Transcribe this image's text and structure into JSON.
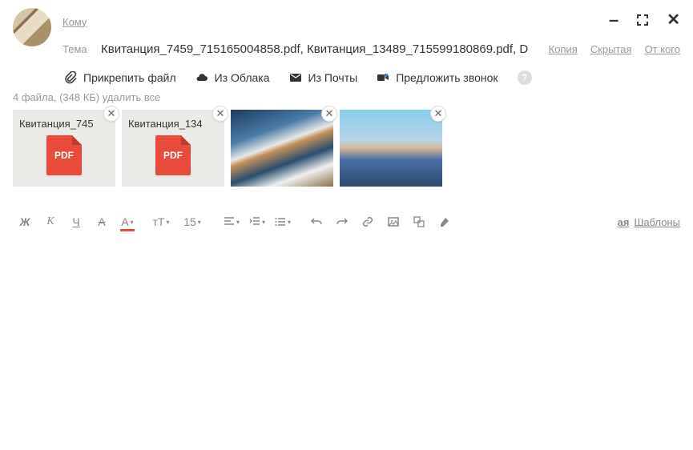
{
  "fields": {
    "to_label": "Кому",
    "subject_label": "Тема",
    "subject_value": "Квитанция_7459_715165004858.pdf, Квитанция_13489_715599180869.pdf, D"
  },
  "links": {
    "copy": "Копия",
    "bcc": "Скрытая",
    "from": "От кого"
  },
  "attach_bar": {
    "attach_file": "Прикрепить файл",
    "from_cloud": "Из Облака",
    "from_mail": "Из Почты",
    "suggest_call": "Предложить звонок"
  },
  "summary": {
    "count": "4 файла, (348 КБ)",
    "delete_all": "удалить все"
  },
  "attachments": [
    {
      "name": "Квитанция_745",
      "type": "pdf",
      "badge": "PDF"
    },
    {
      "name": "Квитанция_134",
      "type": "pdf",
      "badge": "PDF"
    },
    {
      "name": "",
      "type": "image"
    },
    {
      "name": "",
      "type": "image"
    }
  ],
  "toolbar": {
    "bold": "Ж",
    "italic": "К",
    "underline": "Ч",
    "strike": "A",
    "color": "A",
    "fontsize_glyph": "тТ",
    "size": "15",
    "templates": "Шаблоны"
  }
}
